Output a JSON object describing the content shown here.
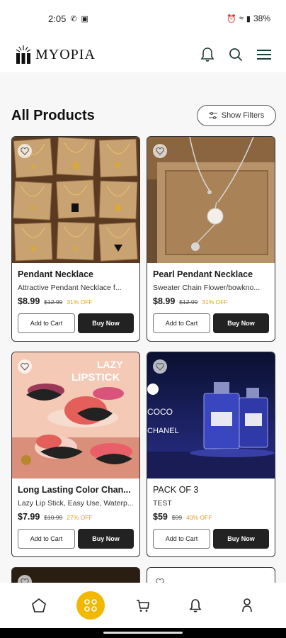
{
  "status_bar": {
    "time": "2:05",
    "battery": "38%"
  },
  "header": {
    "brand": "MYOPIA"
  },
  "page": {
    "title": "All Products",
    "filter_label": "Show Filters"
  },
  "products": [
    {
      "name": "Pendant Necklace",
      "desc": "Attractive Pendant Necklace f...",
      "price": "$8.99",
      "mrp": "$12.99",
      "off": "31% OFF",
      "cart": "Add to Cart",
      "buy": "Buy Now"
    },
    {
      "name": "Pearl Pendant Necklace",
      "desc": "Sweater Chain Flower/bowkno...",
      "price": "$8.99",
      "mrp": "$12.99",
      "off": "31% OFF",
      "cart": "Add to Cart",
      "buy": "Buy Now"
    },
    {
      "name": "Long Lasting Color Chan...",
      "desc": "Lazy Lip Stick, Easy Use, Waterp...",
      "price": "$7.99",
      "mrp": "$10.99",
      "off": "27% OFF",
      "cart": "Add to Cart",
      "buy": "Buy Now",
      "image_text_1": "LAZY",
      "image_text_2": "LIPSTICK"
    },
    {
      "name": "PACK OF 3",
      "desc": "TEST",
      "price": "$59",
      "mrp": "$99",
      "off": "40% OFF",
      "cart": "Add to Cart",
      "buy": "Buy Now",
      "image_text_1": "COCO",
      "image_text_2": "CHANEL"
    }
  ],
  "colors": {
    "accent": "#f2b800",
    "offer": "#e0a020",
    "buy_button": "#222222"
  },
  "icons": {
    "notification": "bell-icon",
    "search": "search-icon",
    "menu": "hamburger-icon",
    "filter": "sliders-icon",
    "favorite": "heart-icon",
    "nav": [
      "home-icon",
      "grid-icon",
      "cart-icon",
      "bell-icon",
      "user-icon"
    ]
  }
}
